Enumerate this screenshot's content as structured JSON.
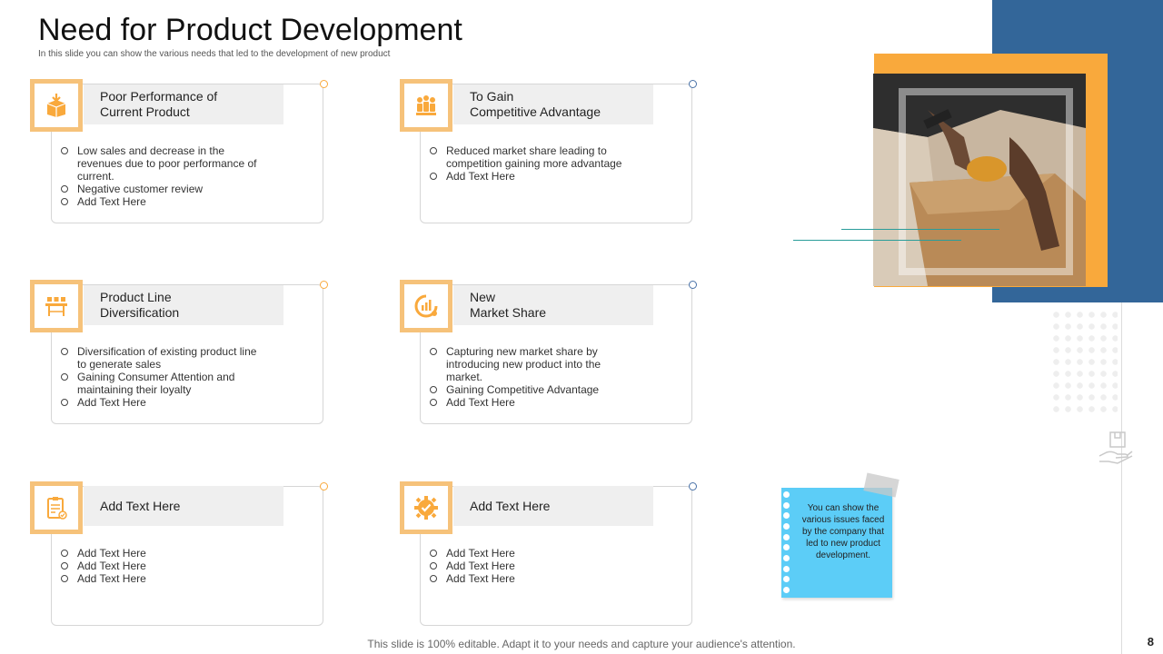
{
  "slide": {
    "title": "Need for Product Development",
    "subtitle": "In this slide you can show the various needs that led to the development of new product",
    "footer": "This slide is 100% editable. Adapt it to your needs and capture your audience's attention.",
    "page_number": "8"
  },
  "colors": {
    "orange": "#f9a93c",
    "blue": "#336699",
    "light_orange": "#f6c27a",
    "sticky": "#5ccdf7",
    "dot_blue": "#4a72a8"
  },
  "cards": [
    {
      "icon": "box-down-icon",
      "title": "Poor Performance of\nCurrent Product",
      "bullets": [
        "Low sales and decrease in the revenues due to poor performance of current.",
        "Negative customer review",
        "Add Text Here"
      ]
    },
    {
      "icon": "team-icon",
      "title": "To Gain\nCompetitive Advantage",
      "bullets": [
        "Reduced market share leading to competition gaining more advantage",
        "Add Text Here"
      ]
    },
    {
      "icon": "conveyor-icon",
      "title": "Product Line\nDiversification",
      "bullets": [
        "Diversification of existing product line to generate sales",
        "Gaining Consumer Attention and maintaining their loyalty",
        "Add Text Here"
      ]
    },
    {
      "icon": "market-chart-icon",
      "title": "New\nMarket Share",
      "bullets": [
        "Capturing new market share by introducing new product into the market.",
        "Gaining Competitive Advantage",
        "Add Text Here"
      ]
    },
    {
      "icon": "clipboard-icon",
      "title": "Add Text Here",
      "bullets": [
        "Add Text Here",
        "Add Text Here",
        "Add Text Here"
      ]
    },
    {
      "icon": "gear-check-icon",
      "title": "Add Text Here",
      "bullets": [
        "Add Text Here",
        "Add Text Here",
        "Add Text Here"
      ]
    }
  ],
  "sticky_note": "You can show the various issues faced by the company that led to new product development."
}
